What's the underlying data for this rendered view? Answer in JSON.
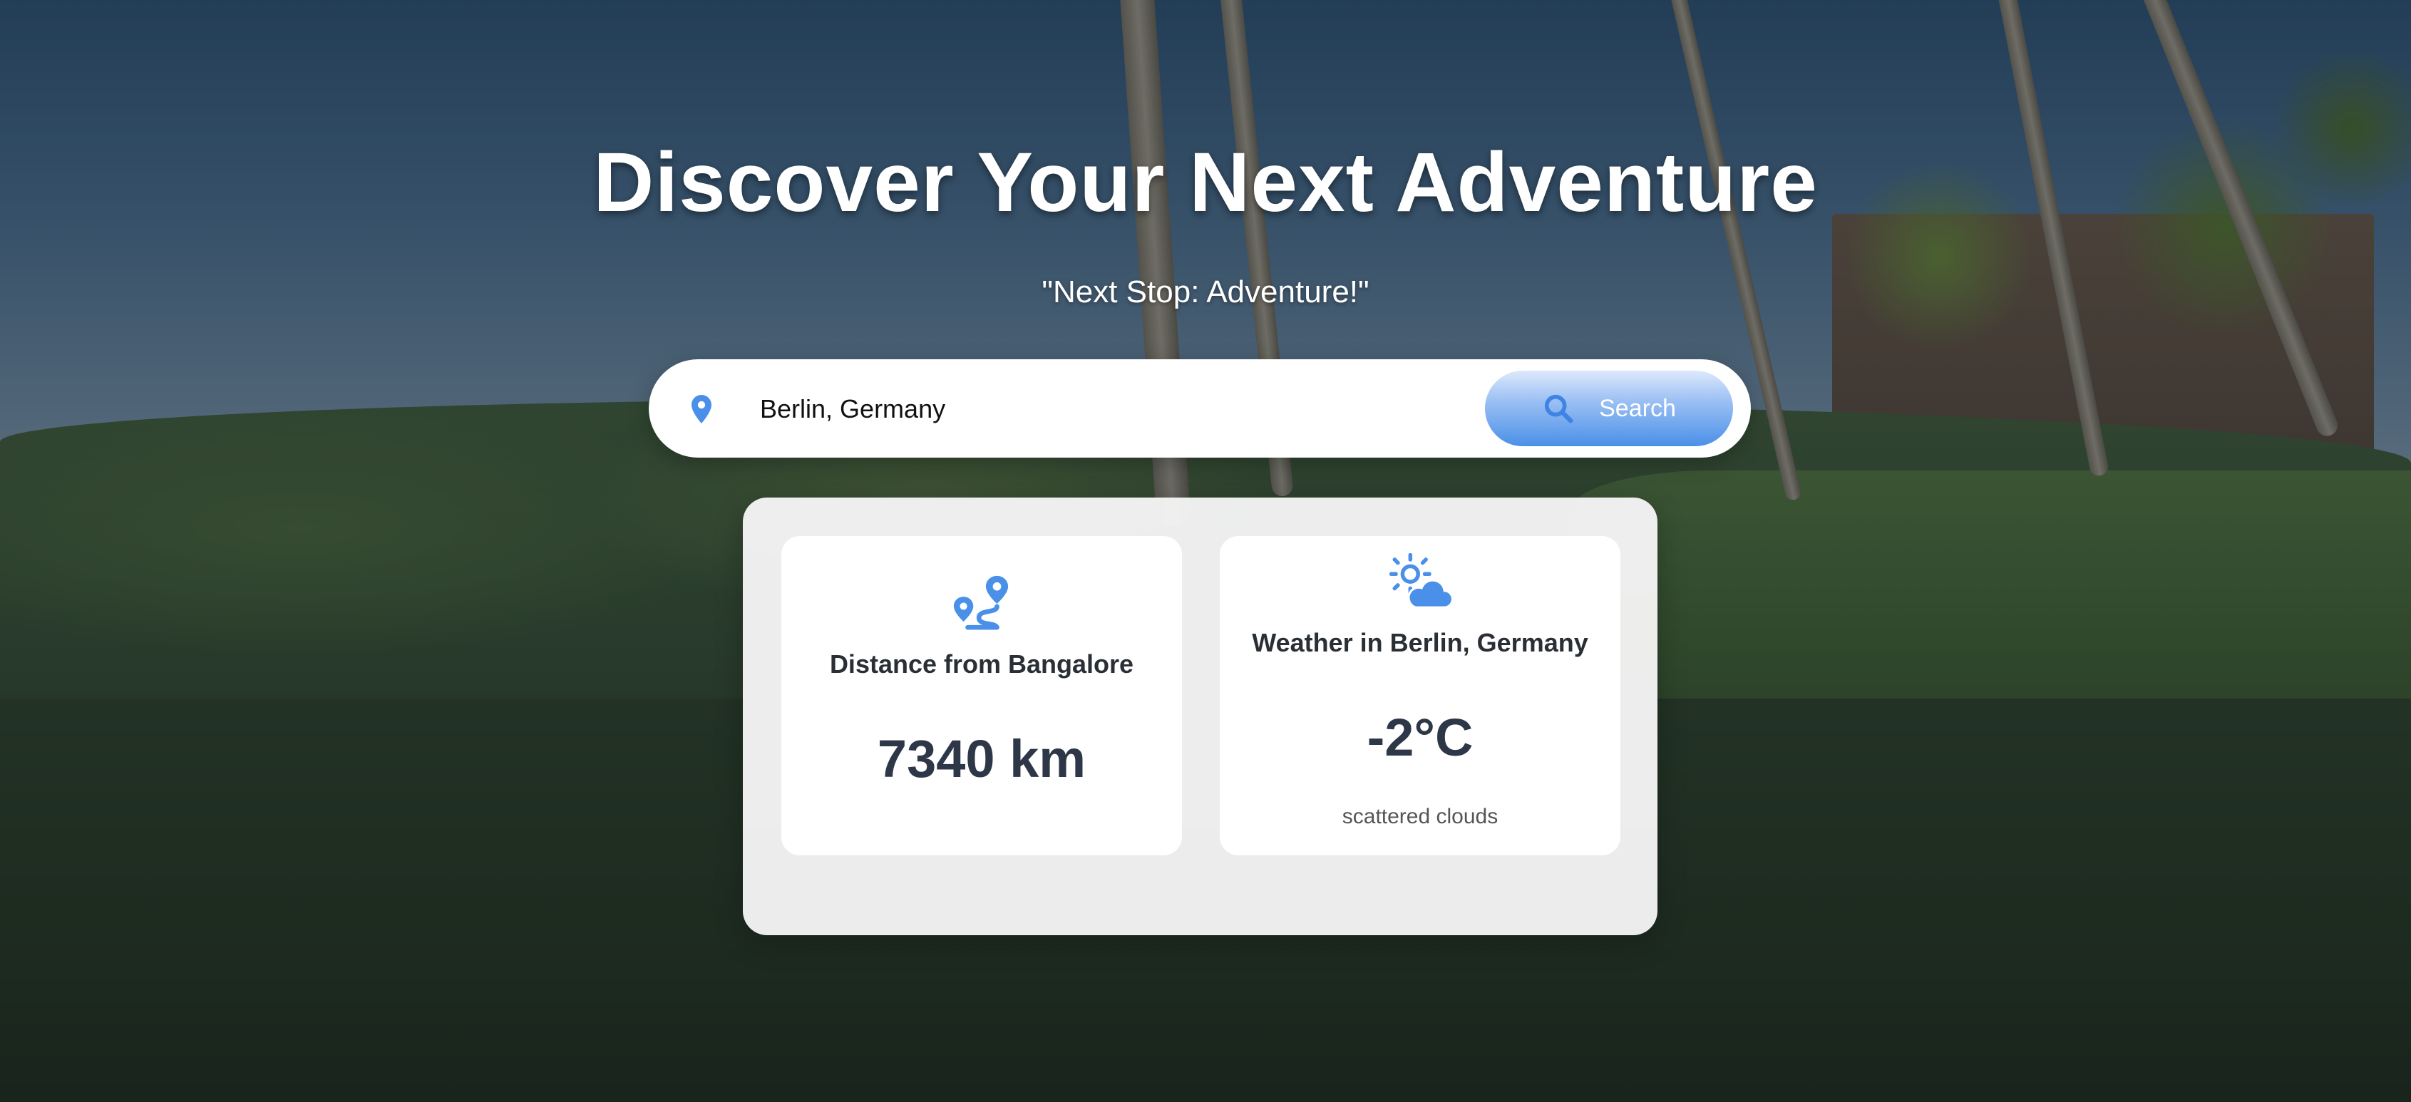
{
  "hero": {
    "title": "Discover Your Next Adventure",
    "subtitle": "\"Next Stop: Adventure!\""
  },
  "search": {
    "value": "Berlin, Germany",
    "button_label": "Search",
    "pin_icon": "map-pin-icon",
    "button_icon": "search-icon"
  },
  "distance_card": {
    "icon": "route-icon",
    "title": "Distance from Bangalore",
    "value": "7340 km"
  },
  "weather_card": {
    "icon": "partly-cloudy-icon",
    "title": "Weather in Berlin, Germany",
    "temperature": "-2°C",
    "description": "scattered clouds"
  },
  "colors": {
    "accent": "#4a90e8",
    "text_dark": "#2d3748",
    "panel_bg": "#f5f5f5",
    "card_bg": "#ffffff"
  }
}
